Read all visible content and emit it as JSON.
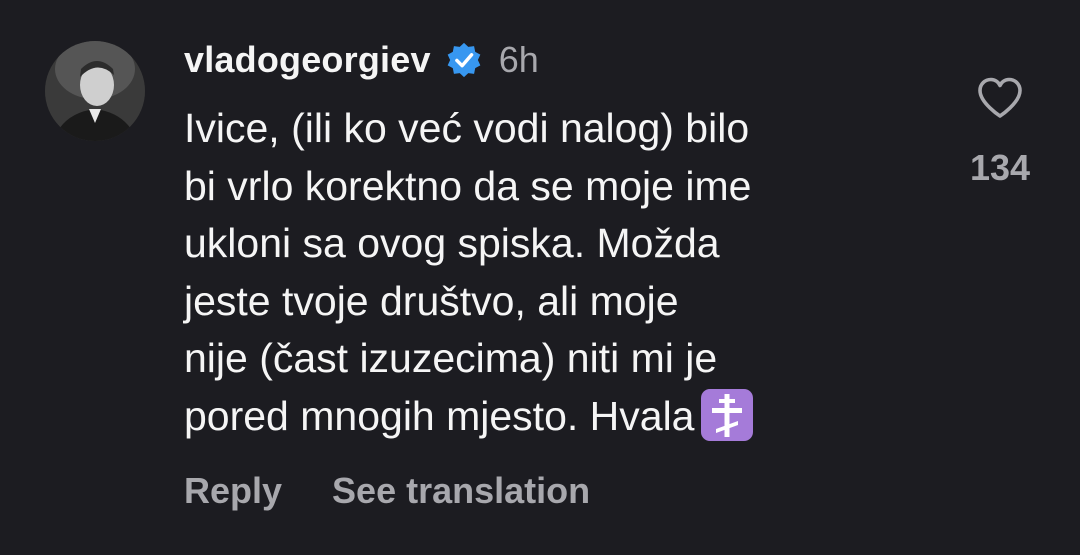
{
  "comment": {
    "username": "vladogeorgiev",
    "verified_icon": "verified-badge-icon",
    "timestamp": "6h",
    "text_lines": [
      "Ivice, (ili ko već vodi nalog) bilo",
      "bi vrlo korektno da se moje ime",
      "ukloni sa ovog spiska. Možda",
      "jeste tvoje društvo, ali moje",
      "nije (čast izuzecima) niti mi je",
      "pored mnogih mjesto. Hvala"
    ],
    "emoji": "orthodox-cross-emoji",
    "like_count": "134",
    "like_icon": "heart-icon"
  },
  "actions": {
    "reply_label": "Reply",
    "translate_label": "See translation"
  },
  "colors": {
    "background": "#1c1c21",
    "primary_text": "#f5f5f5",
    "secondary_text": "#a8a8ad",
    "verified_blue": "#3797f0",
    "emoji_purple": "#a57bd9"
  }
}
